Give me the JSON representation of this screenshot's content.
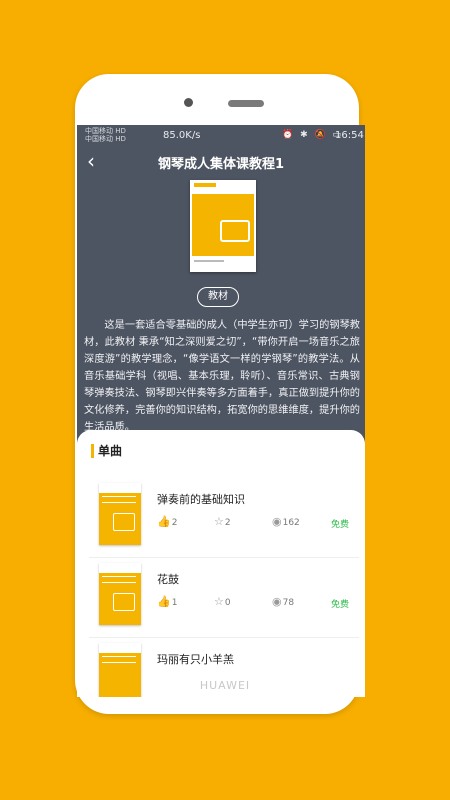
{
  "statusbar": {
    "carrier1": "中国移动 HD",
    "carrier2": "中国移动 HD",
    "speed": "85.0K/s",
    "icons": "⏰ ✱ 🔕 ▭",
    "time": "16:54"
  },
  "nav": {
    "back_icon": "‹",
    "title": "钢琴成人集体课教程1"
  },
  "badge": "教材",
  "description": "这是一套适合零基础的成人（中学生亦可）学习的钢琴教材，此教材 秉承“知之深则爱之切”，“带你开启一场音乐之旅深度游”的教学理念，“像学语文一样的学钢琴”的教学法。从音乐基础学科（视唱、基本乐理，聆听）、音乐常识、古典钢琴弹奏技法、钢琴即兴伴奏等多方面着手，真正做到提升你的文化修养，完善你的知识结构，拓宽你的思维维度，提升你的生活品质。",
  "section_title": "单曲",
  "items": [
    {
      "name": "弹奏前的基础知识",
      "likes": "2",
      "stars": "2",
      "views": "162",
      "tag": "免费"
    },
    {
      "name": "花鼓",
      "likes": "1",
      "stars": "0",
      "views": "78",
      "tag": "免费"
    },
    {
      "name": "玛丽有只小羊羔",
      "likes": "",
      "stars": "",
      "views": "",
      "tag": ""
    }
  ],
  "brand": "HUAWEI",
  "colors": {
    "background": "#F7AE00",
    "accent": "#F5B400",
    "free": "#2bbb4a",
    "header": "#4d5462"
  },
  "icons": {
    "like": "thumb-up-icon",
    "star": "star-icon",
    "view": "eye-icon"
  }
}
